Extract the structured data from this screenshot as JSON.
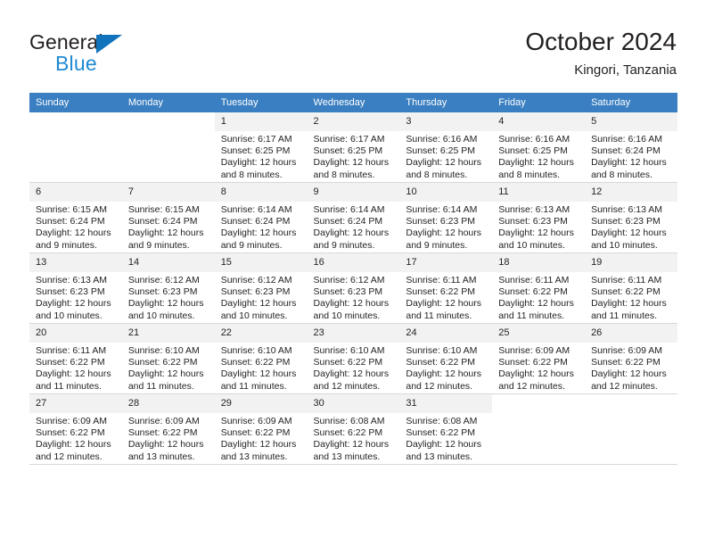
{
  "brand": {
    "name_dark": "General",
    "name_blue": "Blue",
    "dark_color": "#231f20",
    "blue_color": "#1f8ad2",
    "triangle_color": "#1273bd"
  },
  "header": {
    "title": "October 2024",
    "subtitle": "Kingori, Tanzania",
    "header_bg": "#3a7fc1",
    "daynum_bg": "#f2f2f2"
  },
  "weekday_headers": [
    "Sunday",
    "Monday",
    "Tuesday",
    "Wednesday",
    "Thursday",
    "Friday",
    "Saturday"
  ],
  "labels": {
    "sunrise": "Sunrise:",
    "sunset": "Sunset:",
    "daylight": "Daylight:"
  },
  "weeks": [
    [
      {
        "day": "",
        "sunrise": "",
        "sunset": "",
        "daylight_a": "",
        "daylight_b": "",
        "empty": true
      },
      {
        "day": "",
        "sunrise": "",
        "sunset": "",
        "daylight_a": "",
        "daylight_b": "",
        "empty": true
      },
      {
        "day": "1",
        "sunrise": "Sunrise: 6:17 AM",
        "sunset": "Sunset: 6:25 PM",
        "daylight_a": "Daylight: 12 hours",
        "daylight_b": "and 8 minutes."
      },
      {
        "day": "2",
        "sunrise": "Sunrise: 6:17 AM",
        "sunset": "Sunset: 6:25 PM",
        "daylight_a": "Daylight: 12 hours",
        "daylight_b": "and 8 minutes."
      },
      {
        "day": "3",
        "sunrise": "Sunrise: 6:16 AM",
        "sunset": "Sunset: 6:25 PM",
        "daylight_a": "Daylight: 12 hours",
        "daylight_b": "and 8 minutes."
      },
      {
        "day": "4",
        "sunrise": "Sunrise: 6:16 AM",
        "sunset": "Sunset: 6:25 PM",
        "daylight_a": "Daylight: 12 hours",
        "daylight_b": "and 8 minutes."
      },
      {
        "day": "5",
        "sunrise": "Sunrise: 6:16 AM",
        "sunset": "Sunset: 6:24 PM",
        "daylight_a": "Daylight: 12 hours",
        "daylight_b": "and 8 minutes."
      }
    ],
    [
      {
        "day": "6",
        "sunrise": "Sunrise: 6:15 AM",
        "sunset": "Sunset: 6:24 PM",
        "daylight_a": "Daylight: 12 hours",
        "daylight_b": "and 9 minutes."
      },
      {
        "day": "7",
        "sunrise": "Sunrise: 6:15 AM",
        "sunset": "Sunset: 6:24 PM",
        "daylight_a": "Daylight: 12 hours",
        "daylight_b": "and 9 minutes."
      },
      {
        "day": "8",
        "sunrise": "Sunrise: 6:14 AM",
        "sunset": "Sunset: 6:24 PM",
        "daylight_a": "Daylight: 12 hours",
        "daylight_b": "and 9 minutes."
      },
      {
        "day": "9",
        "sunrise": "Sunrise: 6:14 AM",
        "sunset": "Sunset: 6:24 PM",
        "daylight_a": "Daylight: 12 hours",
        "daylight_b": "and 9 minutes."
      },
      {
        "day": "10",
        "sunrise": "Sunrise: 6:14 AM",
        "sunset": "Sunset: 6:23 PM",
        "daylight_a": "Daylight: 12 hours",
        "daylight_b": "and 9 minutes."
      },
      {
        "day": "11",
        "sunrise": "Sunrise: 6:13 AM",
        "sunset": "Sunset: 6:23 PM",
        "daylight_a": "Daylight: 12 hours",
        "daylight_b": "and 10 minutes."
      },
      {
        "day": "12",
        "sunrise": "Sunrise: 6:13 AM",
        "sunset": "Sunset: 6:23 PM",
        "daylight_a": "Daylight: 12 hours",
        "daylight_b": "and 10 minutes."
      }
    ],
    [
      {
        "day": "13",
        "sunrise": "Sunrise: 6:13 AM",
        "sunset": "Sunset: 6:23 PM",
        "daylight_a": "Daylight: 12 hours",
        "daylight_b": "and 10 minutes."
      },
      {
        "day": "14",
        "sunrise": "Sunrise: 6:12 AM",
        "sunset": "Sunset: 6:23 PM",
        "daylight_a": "Daylight: 12 hours",
        "daylight_b": "and 10 minutes."
      },
      {
        "day": "15",
        "sunrise": "Sunrise: 6:12 AM",
        "sunset": "Sunset: 6:23 PM",
        "daylight_a": "Daylight: 12 hours",
        "daylight_b": "and 10 minutes."
      },
      {
        "day": "16",
        "sunrise": "Sunrise: 6:12 AM",
        "sunset": "Sunset: 6:23 PM",
        "daylight_a": "Daylight: 12 hours",
        "daylight_b": "and 10 minutes."
      },
      {
        "day": "17",
        "sunrise": "Sunrise: 6:11 AM",
        "sunset": "Sunset: 6:22 PM",
        "daylight_a": "Daylight: 12 hours",
        "daylight_b": "and 11 minutes."
      },
      {
        "day": "18",
        "sunrise": "Sunrise: 6:11 AM",
        "sunset": "Sunset: 6:22 PM",
        "daylight_a": "Daylight: 12 hours",
        "daylight_b": "and 11 minutes."
      },
      {
        "day": "19",
        "sunrise": "Sunrise: 6:11 AM",
        "sunset": "Sunset: 6:22 PM",
        "daylight_a": "Daylight: 12 hours",
        "daylight_b": "and 11 minutes."
      }
    ],
    [
      {
        "day": "20",
        "sunrise": "Sunrise: 6:11 AM",
        "sunset": "Sunset: 6:22 PM",
        "daylight_a": "Daylight: 12 hours",
        "daylight_b": "and 11 minutes."
      },
      {
        "day": "21",
        "sunrise": "Sunrise: 6:10 AM",
        "sunset": "Sunset: 6:22 PM",
        "daylight_a": "Daylight: 12 hours",
        "daylight_b": "and 11 minutes."
      },
      {
        "day": "22",
        "sunrise": "Sunrise: 6:10 AM",
        "sunset": "Sunset: 6:22 PM",
        "daylight_a": "Daylight: 12 hours",
        "daylight_b": "and 11 minutes."
      },
      {
        "day": "23",
        "sunrise": "Sunrise: 6:10 AM",
        "sunset": "Sunset: 6:22 PM",
        "daylight_a": "Daylight: 12 hours",
        "daylight_b": "and 12 minutes."
      },
      {
        "day": "24",
        "sunrise": "Sunrise: 6:10 AM",
        "sunset": "Sunset: 6:22 PM",
        "daylight_a": "Daylight: 12 hours",
        "daylight_b": "and 12 minutes."
      },
      {
        "day": "25",
        "sunrise": "Sunrise: 6:09 AM",
        "sunset": "Sunset: 6:22 PM",
        "daylight_a": "Daylight: 12 hours",
        "daylight_b": "and 12 minutes."
      },
      {
        "day": "26",
        "sunrise": "Sunrise: 6:09 AM",
        "sunset": "Sunset: 6:22 PM",
        "daylight_a": "Daylight: 12 hours",
        "daylight_b": "and 12 minutes."
      }
    ],
    [
      {
        "day": "27",
        "sunrise": "Sunrise: 6:09 AM",
        "sunset": "Sunset: 6:22 PM",
        "daylight_a": "Daylight: 12 hours",
        "daylight_b": "and 12 minutes."
      },
      {
        "day": "28",
        "sunrise": "Sunrise: 6:09 AM",
        "sunset": "Sunset: 6:22 PM",
        "daylight_a": "Daylight: 12 hours",
        "daylight_b": "and 13 minutes."
      },
      {
        "day": "29",
        "sunrise": "Sunrise: 6:09 AM",
        "sunset": "Sunset: 6:22 PM",
        "daylight_a": "Daylight: 12 hours",
        "daylight_b": "and 13 minutes."
      },
      {
        "day": "30",
        "sunrise": "Sunrise: 6:08 AM",
        "sunset": "Sunset: 6:22 PM",
        "daylight_a": "Daylight: 12 hours",
        "daylight_b": "and 13 minutes."
      },
      {
        "day": "31",
        "sunrise": "Sunrise: 6:08 AM",
        "sunset": "Sunset: 6:22 PM",
        "daylight_a": "Daylight: 12 hours",
        "daylight_b": "and 13 minutes."
      },
      {
        "day": "",
        "sunrise": "",
        "sunset": "",
        "daylight_a": "",
        "daylight_b": "",
        "empty": true
      },
      {
        "day": "",
        "sunrise": "",
        "sunset": "",
        "daylight_a": "",
        "daylight_b": "",
        "empty": true
      }
    ]
  ]
}
